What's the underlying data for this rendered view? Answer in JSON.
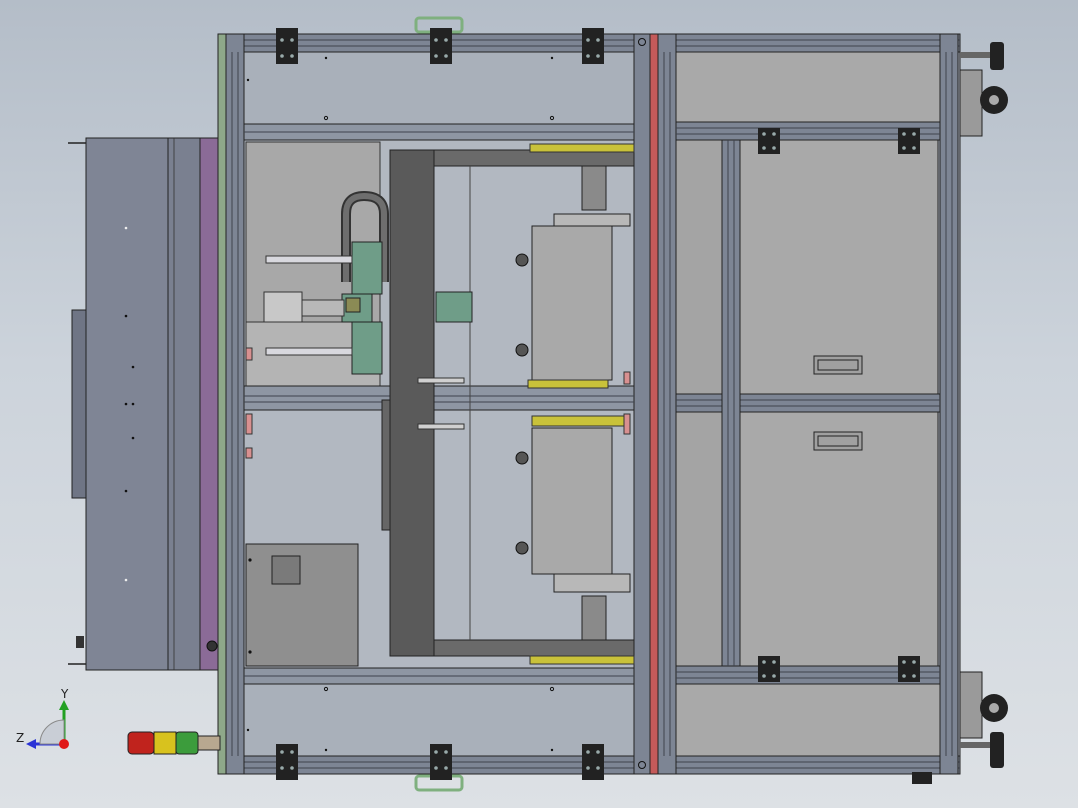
{
  "viewport": {
    "triad": {
      "y_label": "Y",
      "z_label": "Z",
      "y_color": "#22a022",
      "z_color": "#2a33d6",
      "x_color": "#e01818"
    }
  },
  "colors": {
    "frame": "#7d8594",
    "frame_dark": "#4a505c",
    "panel": "#a9b0ba",
    "panel_dark": "#8f8f8f",
    "cabinet": "#7f8595",
    "purple_band": "#8b6b97",
    "red_divider": "#c45a5a",
    "yellow_bar": "#c9c23a",
    "green_part": "#6f9d88",
    "dark_beam": "#555555",
    "stack_light_red": "#c0231d",
    "stack_light_yellow": "#d8c21e",
    "stack_light_green": "#3c9c3c"
  },
  "icons": {
    "stack_light": "signal-tower-icon",
    "triad": "coordinate-triad-icon",
    "caster": "caster-wheel-icon",
    "leveling_foot": "leveling-foot-icon",
    "handle": "handle-icon"
  }
}
